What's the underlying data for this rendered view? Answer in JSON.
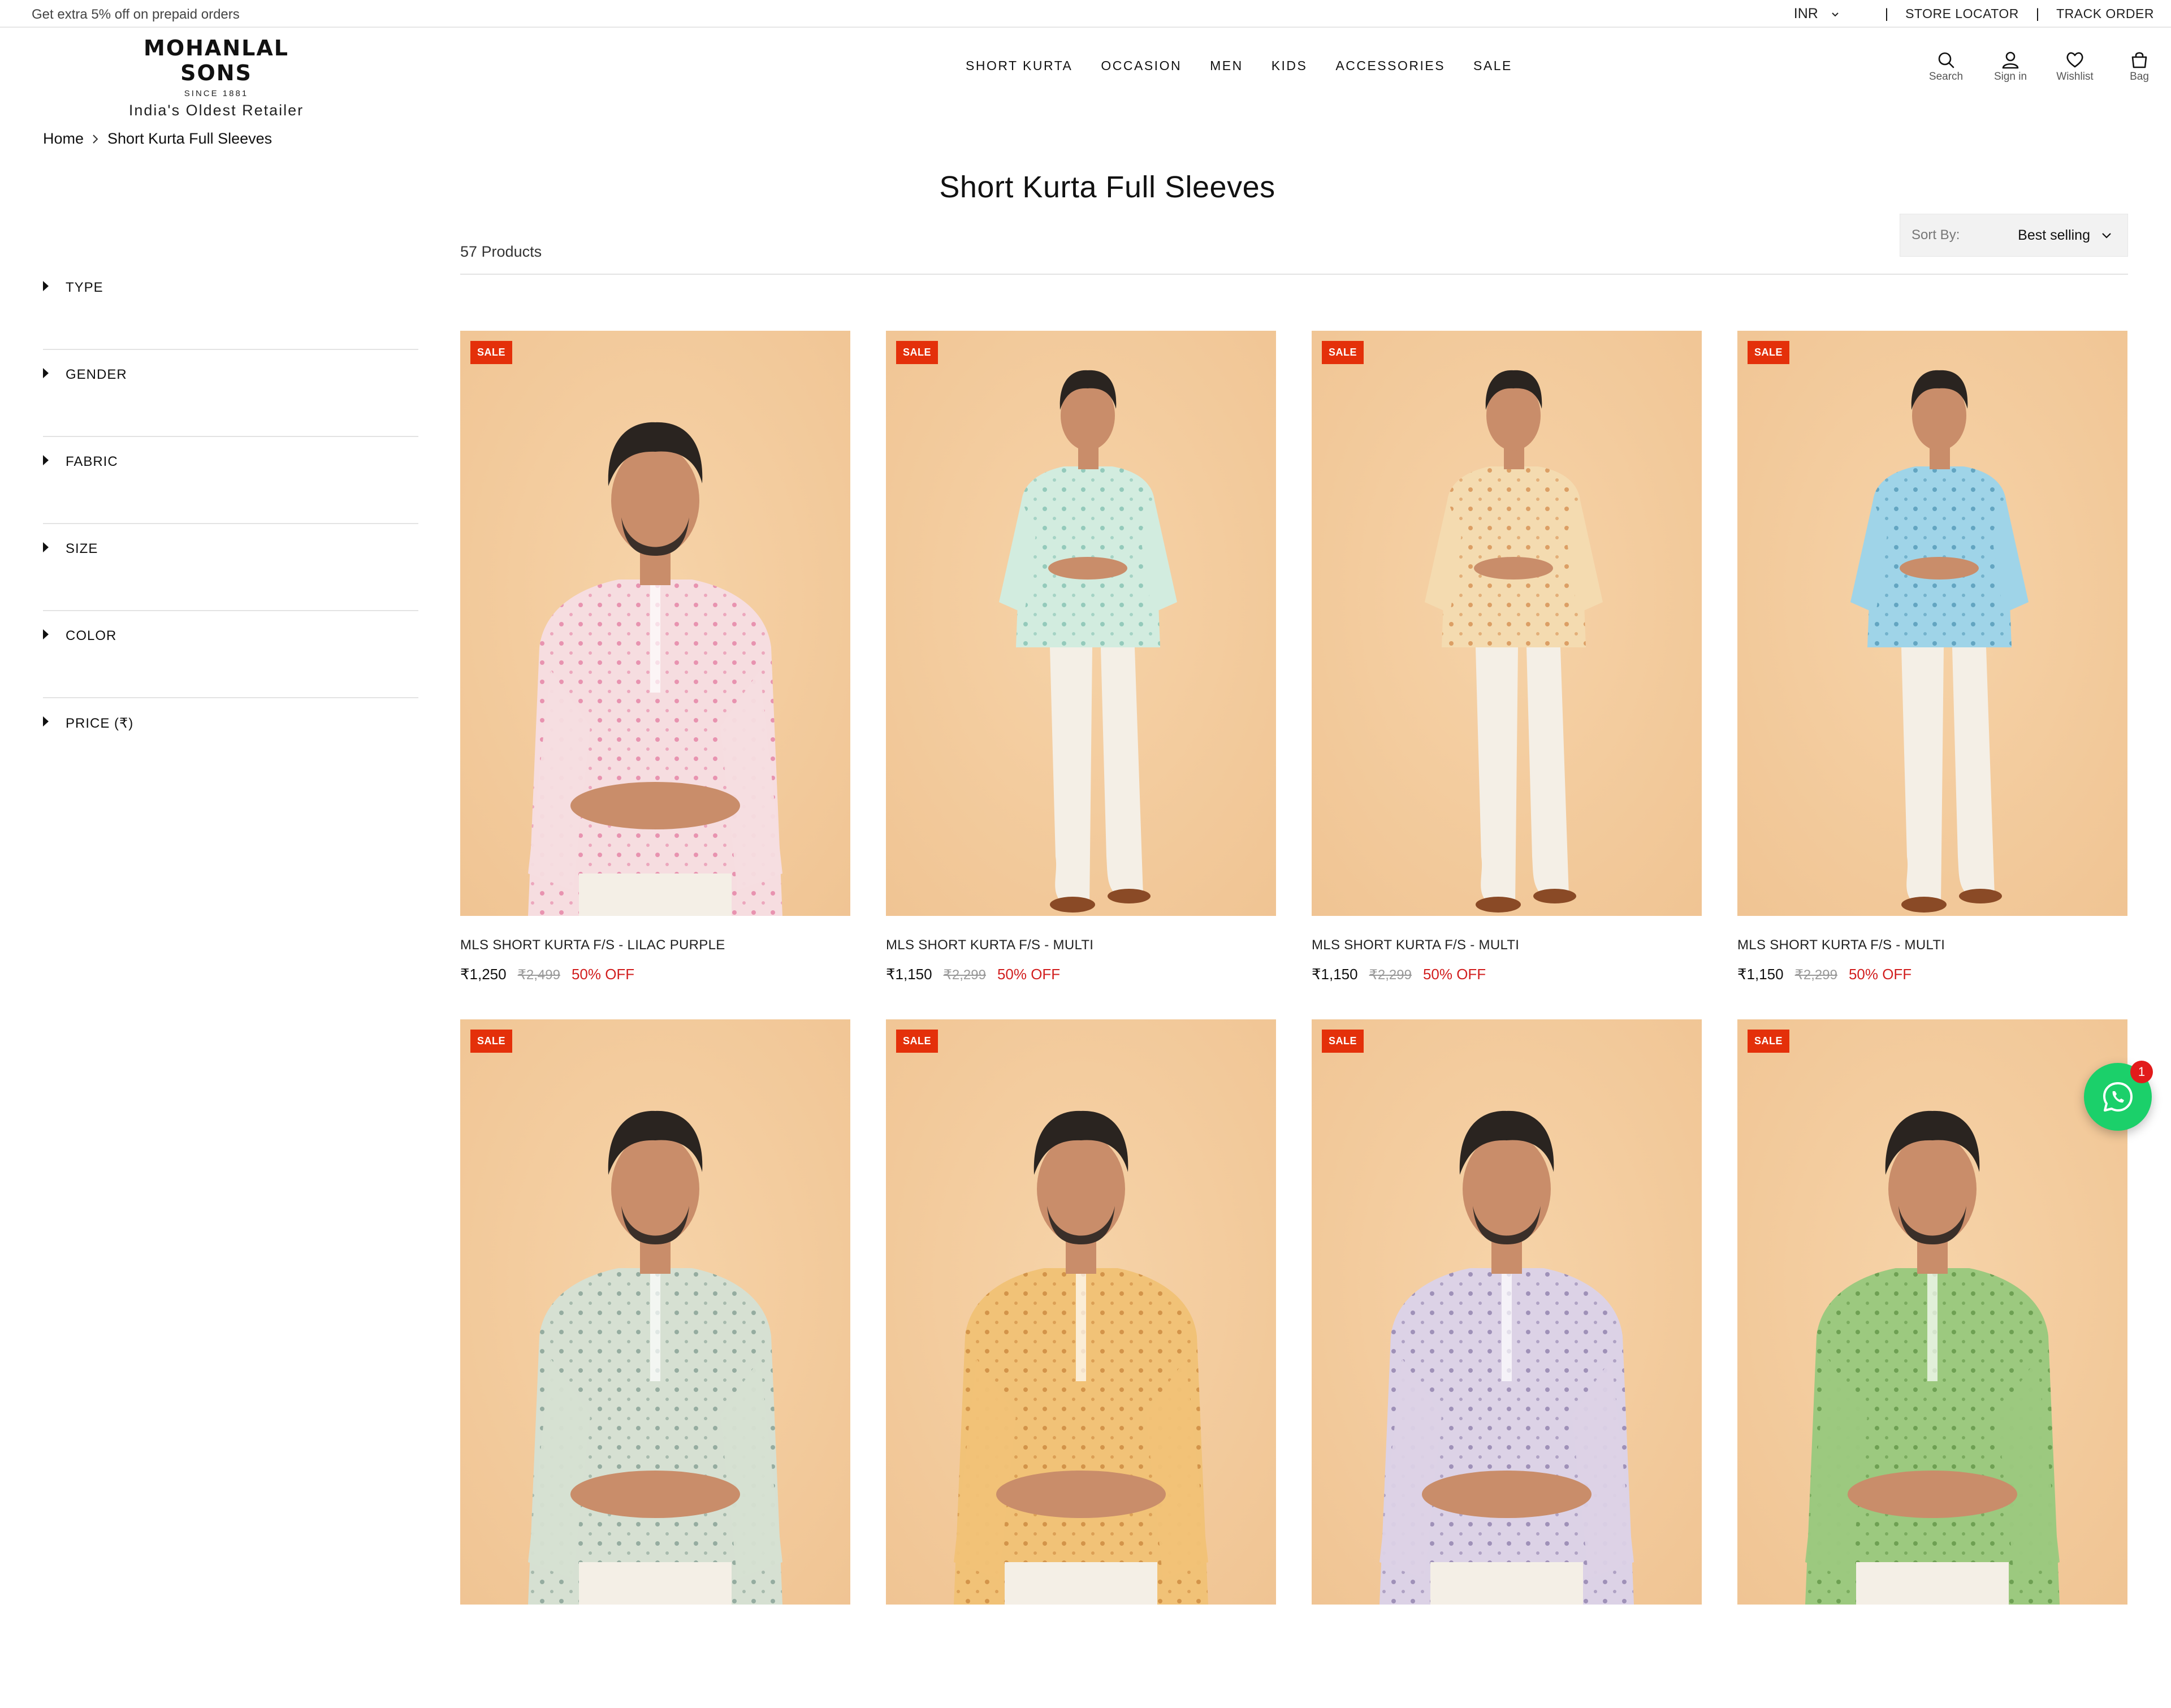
{
  "topbar": {
    "promo": "Get extra 5% off on prepaid orders",
    "currency": "INR",
    "store_locator": "STORE LOCATOR",
    "track_order": "TRACK ORDER",
    "separator": "|"
  },
  "header": {
    "brand": "MOHANLAL SONS",
    "since": "SINCE 1881",
    "tagline": "India's Oldest Retailer",
    "nav": [
      "SHORT KURTA",
      "OCCASION",
      "MEN",
      "KIDS",
      "ACCESSORIES",
      "SALE"
    ],
    "icons": [
      {
        "icon": "search-icon",
        "label": "Search"
      },
      {
        "icon": "user-icon",
        "label": "Sign in"
      },
      {
        "icon": "heart-icon",
        "label": "Wishlist"
      },
      {
        "icon": "bag-icon",
        "label": "Bag"
      }
    ]
  },
  "breadcrumb": {
    "home": "Home",
    "current": "Short Kurta Full Sleeves"
  },
  "page": {
    "title": "Short Kurta Full Sleeves",
    "count": "57 Products"
  },
  "sort": {
    "label": "Sort By:",
    "value": "Best selling"
  },
  "filters": [
    "TYPE",
    "GENDER",
    "FABRIC",
    "SIZE",
    "COLOR",
    "PRICE (₹)"
  ],
  "colors": {
    "sale_badge": "#e4300a",
    "discount": "#d21e1e",
    "background_tan": "#f0c493",
    "whatsapp": "#1bd06a"
  },
  "products": [
    {
      "badge": "SALE",
      "name": "MLS SHORT KURTA F/S - LILAC PURPLE",
      "price": "₹1,250",
      "mrp": "₹2,499",
      "discount": "50% OFF",
      "kurta_color": "#f6dde0",
      "print_color": "#e37aa0",
      "pose": "closeup"
    },
    {
      "badge": "SALE",
      "name": "MLS SHORT KURTA F/S - MULTI",
      "price": "₹1,150",
      "mrp": "₹2,299",
      "discount": "50% OFF",
      "kurta_color": "#d2ecdf",
      "print_color": "#7fbfae",
      "pose": "crossed"
    },
    {
      "badge": "SALE",
      "name": "MLS SHORT KURTA F/S - MULTI",
      "price": "₹1,150",
      "mrp": "₹2,299",
      "discount": "50% OFF",
      "kurta_color": "#f4dbb0",
      "print_color": "#d48a4c",
      "pose": "crossed"
    },
    {
      "badge": "SALE",
      "name": "MLS SHORT KURTA F/S - MULTI",
      "price": "₹1,150",
      "mrp": "₹2,299",
      "discount": "50% OFF",
      "kurta_color": "#9fd4e8",
      "print_color": "#4f95b4",
      "pose": "standing"
    },
    {
      "badge": "SALE",
      "name": "",
      "price": "",
      "mrp": "",
      "discount": "",
      "kurta_color": "#d6e0d2",
      "print_color": "#7f9a8e",
      "pose": "closeup"
    },
    {
      "badge": "SALE",
      "name": "",
      "price": "",
      "mrp": "",
      "discount": "",
      "kurta_color": "#f1c277",
      "print_color": "#c9843a",
      "pose": "closeup"
    },
    {
      "badge": "SALE",
      "name": "",
      "price": "",
      "mrp": "",
      "discount": "",
      "kurta_color": "#dcd2e6",
      "print_color": "#8a7aa8",
      "pose": "closeup"
    },
    {
      "badge": "SALE",
      "name": "",
      "price": "",
      "mrp": "",
      "discount": "",
      "kurta_color": "#9cc97f",
      "print_color": "#5f9244",
      "pose": "closeup"
    }
  ],
  "whatsapp": {
    "count": "1"
  }
}
